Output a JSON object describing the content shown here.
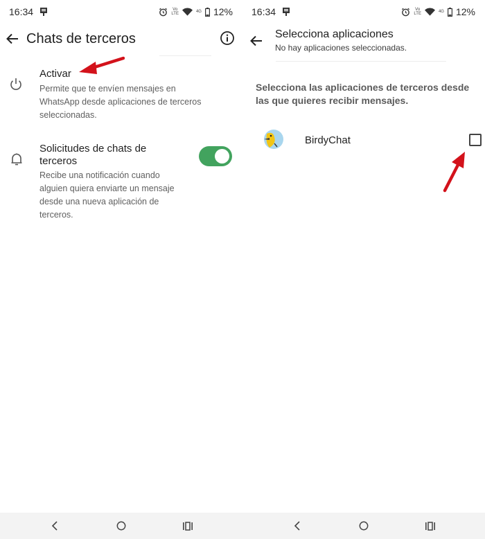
{
  "status_bar": {
    "time": "16:34",
    "volte_top": "Vo",
    "volte_bottom": "LTE",
    "network_label": "4G",
    "battery": "12%"
  },
  "left_screen": {
    "title": "Chats de terceros",
    "activate": {
      "title": "Activar",
      "description": "Permite que te envíen mensajes en WhatsApp desde aplicaciones de terceros seleccionadas."
    },
    "requests": {
      "title": "Solicitudes de chats de terceros",
      "description": "Recibe una notificación cuando alguien quiera enviarte un mensaje desde una nueva aplicación de terceros.",
      "toggle_on": true
    }
  },
  "right_screen": {
    "title": "Selecciona aplicaciones",
    "subtitle": "No hay aplicaciones seleccionadas.",
    "section_text": "Selecciona las aplicaciones de terceros desde las que quieres recibir mensajes.",
    "apps": [
      {
        "name": "BirdyChat",
        "checked": false
      }
    ]
  },
  "colors": {
    "toggle_on": "#42a35e",
    "annotation_arrow": "#d3121b",
    "nav_bar_bg": "#f3f3f3"
  },
  "icons": {
    "back": "arrow-left-icon",
    "info": "info-icon",
    "power": "power-icon",
    "bell": "bell-icon",
    "alarm": "alarm-icon",
    "wifi": "wifi-icon",
    "battery": "battery-icon",
    "nav_back": "chevron-left-icon",
    "nav_home": "circle-icon",
    "nav_recents": "recents-icon"
  }
}
